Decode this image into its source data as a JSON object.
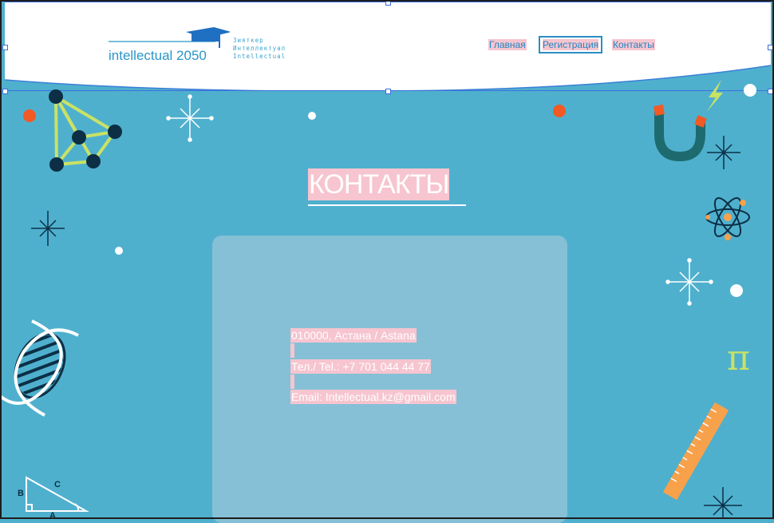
{
  "logo": {
    "name": "intellectual 2050",
    "sub_lines": [
      "Зияткер",
      "Интеллектуал",
      "Intellectual"
    ]
  },
  "nav": {
    "home": "Главная",
    "register": "Регистрация",
    "contacts": "Контакты"
  },
  "page": {
    "title": "КОНТАКТЫ"
  },
  "contacts": {
    "address": "010000, Астана / Astana",
    "phone": "Тел./ Tel.:  +7 701 044 44 77",
    "email": "Email: Intellectual.kz@gmail.com"
  },
  "decorations": {
    "pi_symbol": "π",
    "triangle_labels": [
      "B",
      "C",
      "A"
    ]
  },
  "colors": {
    "background": "#4fb0ce",
    "panel": "#86c0d6",
    "accent_orange": "#f15a24",
    "accent_lime": "#c9e265",
    "dark_navy": "#0c2f45",
    "highlight_pink": "#f6c5d0"
  },
  "icons": [
    "molecule-icon",
    "sparkle-icon",
    "magnet-icon",
    "lightning-icon",
    "atom-icon",
    "dna-icon",
    "pi-icon",
    "ruler-icon",
    "triangle-icon",
    "graduation-cap-icon"
  ]
}
